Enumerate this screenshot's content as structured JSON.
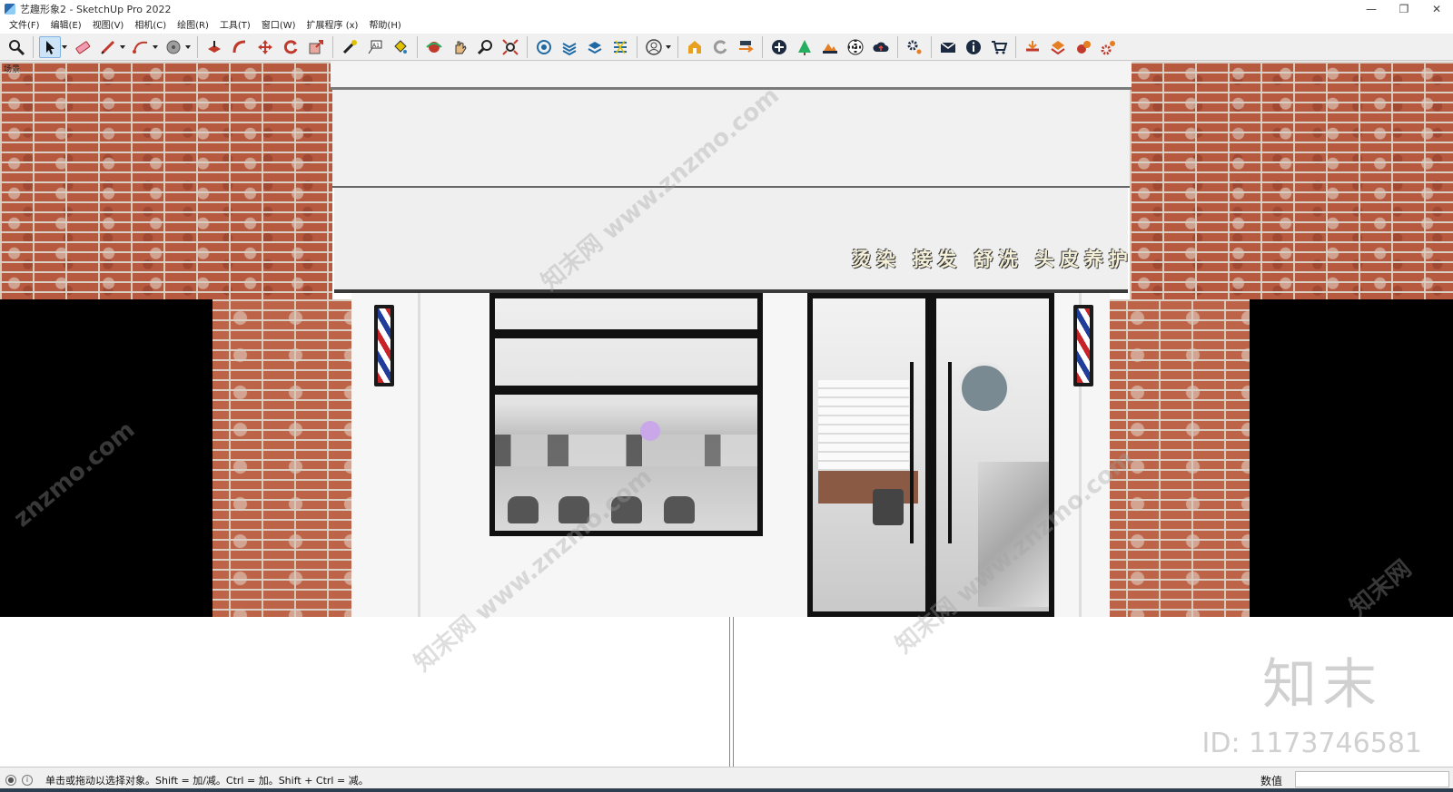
{
  "window": {
    "title": "艺趣形象2 - SketchUp Pro 2022",
    "controls": [
      "minimize",
      "restore",
      "close"
    ]
  },
  "menu": {
    "items": [
      "文件(F)",
      "编辑(E)",
      "视图(V)",
      "相机(C)",
      "绘图(R)",
      "工具(T)",
      "窗口(W)",
      "扩展程序 (x)",
      "帮助(H)"
    ]
  },
  "toolbar": {
    "tools": [
      "zoom-icon",
      "select-icon",
      "eraser-icon",
      "pencil-icon",
      "arc-icon",
      "shape-icon",
      "paint-icon",
      "pushpull-icon",
      "move-icon",
      "rotate-icon",
      "scale-icon",
      "tape-icon",
      "text-icon",
      "paint-bucket-icon",
      "orbit-icon",
      "pan-icon",
      "zoom-window-icon",
      "zoom-extents-icon",
      "components-icon",
      "layers-icon",
      "outliner-icon",
      "styles-icon",
      "user-icon",
      "warehouse-icon",
      "refresh-icon",
      "export-icon",
      "add-icon",
      "tree-icon",
      "terrain-icon",
      "checker-icon",
      "cloud-icon",
      "settings-icon",
      "mail-icon",
      "info-icon",
      "cart-icon",
      "plugin1-icon",
      "plugin2-icon",
      "plugin3-icon",
      "plugin4-icon"
    ]
  },
  "viewport": {
    "scene_label": "场景",
    "sign_text": "烫染 接发 舒洗 头皮养护",
    "watermarks": [
      "知末网 www.znzmo.com",
      "知末网 www.znzmo.com",
      "知末网 www.znzmo.com",
      "znzmo.com",
      "知末网"
    ],
    "logo": "知末",
    "id_text": "ID: 1173746581"
  },
  "status": {
    "hint": "单击或拖动以选择对象。Shift = 加/减。Ctrl = 加。Shift + Ctrl = 减。",
    "measure_label": "数值",
    "measure_value": ""
  },
  "colors": {
    "brick": "#b6593f",
    "mortar": "#d6cabd",
    "frame": "#111111",
    "storefront": "#f6f6f6"
  }
}
